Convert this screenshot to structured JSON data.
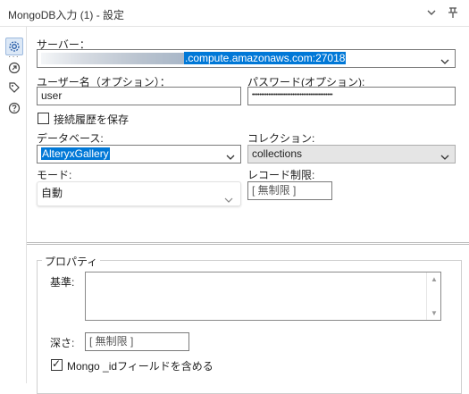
{
  "window": {
    "title": "MongoDB入力 (1) - 設定",
    "menu_icon": "chevron-down-icon",
    "pin_icon": "pin-icon"
  },
  "sidebar": {
    "dots": "···",
    "items": [
      {
        "name": "configuration",
        "icon": "gear-icon",
        "active": true
      },
      {
        "name": "connections",
        "icon": "arrow-circle-icon",
        "active": false
      },
      {
        "name": "annotation",
        "icon": "tag-icon",
        "active": false
      },
      {
        "name": "help",
        "icon": "question-icon",
        "active": false
      }
    ]
  },
  "form": {
    "server_label": "サーバー：",
    "server_value_suffix": ".compute.amazonaws.com:27018",
    "username_label": "ユーザー名（オプション）：",
    "username_value": "user",
    "password_label": "パスワード(オプション):",
    "password_value": "••••••••••••••••••••••••••••••••••••••••••••",
    "save_history_label": "接続履歴を保存",
    "save_history_checked": false,
    "database_label": "データベース:",
    "database_value": "AlteryxGallery",
    "collection_label": "コレクション:",
    "collection_value": "collections",
    "mode_label": "モード:",
    "mode_value": "自動",
    "record_limit_label": "レコード制限:",
    "record_limit_placeholder": "[ 無制限 ]"
  },
  "properties": {
    "legend": "プロパティ",
    "query_label": "基準:",
    "query_value": "",
    "depth_label": "深さ:",
    "depth_placeholder": "[ 無制限 ]",
    "include_id_label": "Mongo _idフィールドを含める",
    "include_id_checked": true
  },
  "colors": {
    "selection": "#0078d7",
    "active_sidebar": "#dce8f6"
  }
}
